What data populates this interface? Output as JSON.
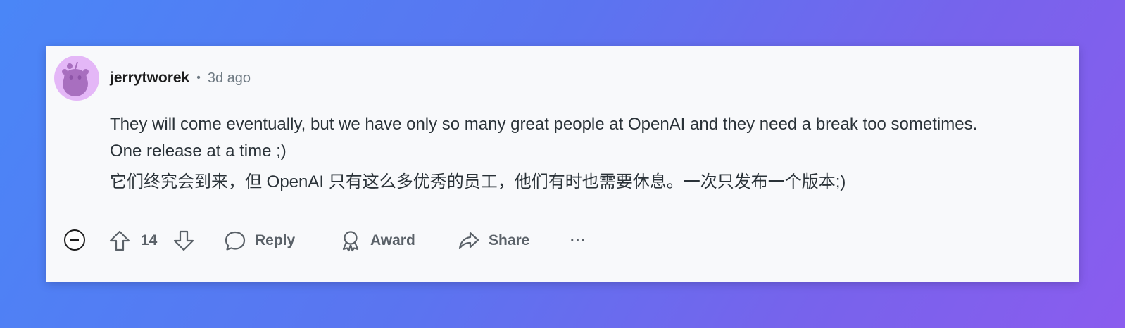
{
  "comment": {
    "author": "jerrytworek",
    "separator": "•",
    "timestamp": "3d ago",
    "body_en": "They will come eventually, but we have only so many great people at OpenAI and they need a break too sometimes. One release at a time ;)",
    "body_zh": "它们终究会到来，但 OpenAI 只有这么多优秀的员工，他们有时也需要休息。一次只发布一个版本;)"
  },
  "actions": {
    "score": "14",
    "reply_label": "Reply",
    "award_label": "Award",
    "share_label": "Share",
    "more_label": "···"
  },
  "icons": {
    "collapse": "minus-circle-icon",
    "upvote": "arrow-up-icon",
    "downvote": "arrow-down-icon",
    "reply": "speech-bubble-icon",
    "award": "award-ribbon-icon",
    "share": "share-arrow-icon",
    "avatar": "reddit-snoo-icon"
  },
  "colors": {
    "avatar_bg": "#e4b7f7",
    "card_bg": "#f8f9fb",
    "action_text": "#5a6168",
    "body_text": "#2a3238"
  }
}
